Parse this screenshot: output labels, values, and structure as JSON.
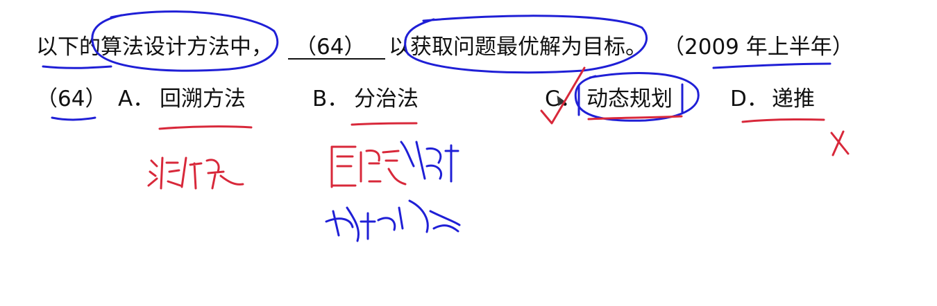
{
  "question": {
    "prefix": "以下的算法设计方法中，",
    "blank_number": "（64）",
    "suffix": "以获取问题最优解为目标。",
    "year": "（2009 年上半年）"
  },
  "options": {
    "number": "（64）",
    "a_letter": "A．",
    "a_text": "回溯方法",
    "b_letter": "B．",
    "b_text": "分治法",
    "c_letter": "C．",
    "c_text": "动态规划",
    "d_letter": "D．",
    "d_text": "递推"
  },
  "ink_colors": {
    "red": "#d8283a",
    "blue": "#1f1fd6"
  }
}
